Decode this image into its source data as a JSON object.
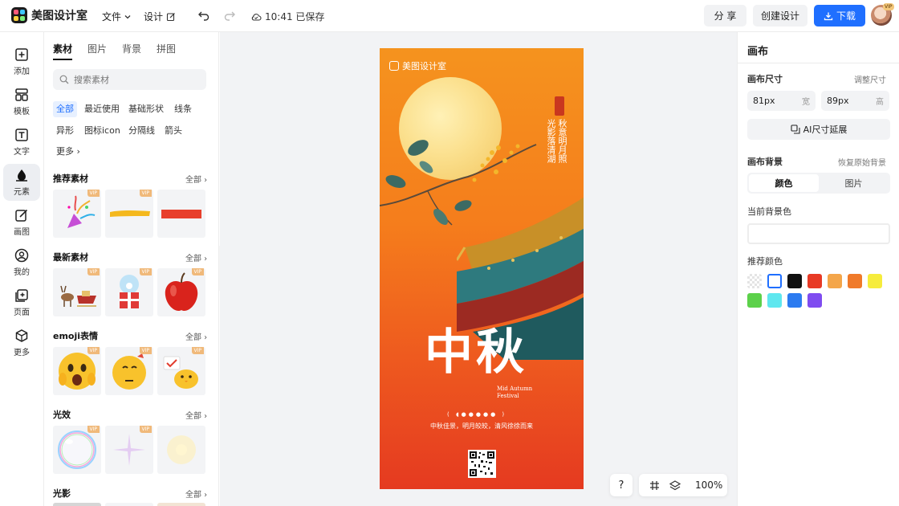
{
  "app": {
    "name": "美图设计室",
    "menu_file": "文件",
    "menu_design": "设计",
    "saved_status": "10:41 已保存",
    "share": "分 享",
    "create": "创建设计",
    "download": "下载",
    "avatar_badge": "VIP"
  },
  "rail": [
    {
      "label": "添加"
    },
    {
      "label": "模板"
    },
    {
      "label": "文字"
    },
    {
      "label": "元素"
    },
    {
      "label": "画图"
    },
    {
      "label": "我的"
    },
    {
      "label": "页面"
    },
    {
      "label": "更多"
    }
  ],
  "panel": {
    "tabs": [
      "素材",
      "图片",
      "背景",
      "拼图"
    ],
    "search_placeholder": "搜索素材",
    "chips": [
      "全部",
      "最近使用",
      "基础形状",
      "线条",
      "异形",
      "图标icon",
      "分隔线",
      "箭头",
      "更多"
    ],
    "sections": [
      {
        "title": "推荐素材",
        "all": "全部"
      },
      {
        "title": "最新素材",
        "all": "全部"
      },
      {
        "title": "emoji表情",
        "all": "全部"
      },
      {
        "title": "光效",
        "all": "全部"
      },
      {
        "title": "光影",
        "all": "全部"
      }
    ],
    "vip_badge": "VIP"
  },
  "poster": {
    "logo": "美图设计室",
    "vertical_1": "秋意明月照",
    "vertical_2": "光影落清湖",
    "title_cn": "中秋",
    "title_en_1": "Mid  Autumn",
    "title_en_2": "Festival",
    "dots": "( ◖●●●●● )",
    "tagline": "中秋佳景，明月皎皎，清风徐徐而来"
  },
  "canvas_tools": {
    "help": "?",
    "zoom": "100%"
  },
  "right_panel": {
    "title": "画布",
    "size_label": "画布尺寸",
    "size_link": "调整尺寸",
    "width_value": "81px",
    "width_unit": "宽",
    "height_value": "89px",
    "height_unit": "高",
    "ai_button": "AI尺寸延展",
    "bg_label": "画布背景",
    "bg_link": "恢复原始背景",
    "seg_color": "颜色",
    "seg_image": "图片",
    "current_bg_label": "当前背景色",
    "recommended_label": "推荐颜色",
    "swatches": [
      "transparent",
      "#ffffff",
      "#111111",
      "#e83a25",
      "#f4a64a",
      "#f07a2a",
      "#f6ec3c",
      "#5cd14a",
      "#5fe7ef",
      "#2c7bf0",
      "#7f4cf0"
    ]
  }
}
